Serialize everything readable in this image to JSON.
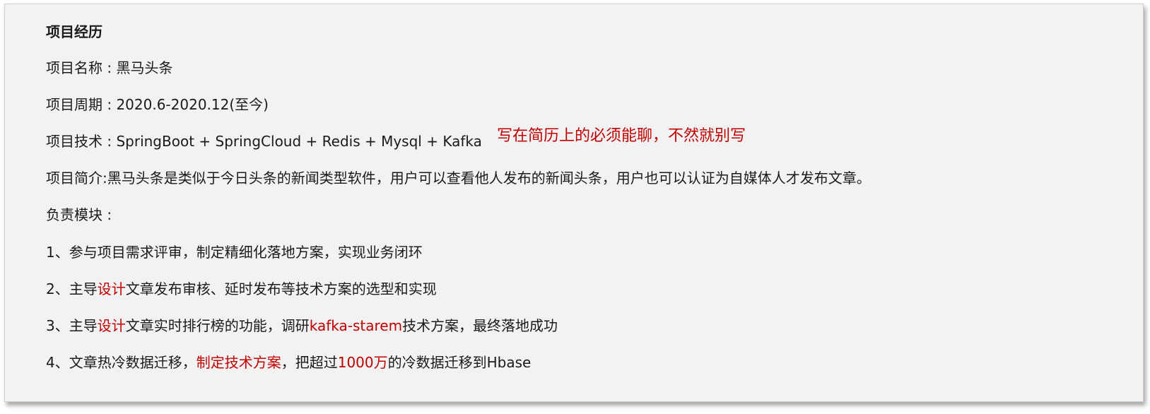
{
  "heading": "项目经历",
  "project_name": {
    "label": "项目名称 : ",
    "value": "黑马头条"
  },
  "project_period": {
    "label": "项目周期 : ",
    "value": "2020.6-2020.12(至今)"
  },
  "project_tech": {
    "label": "项目技术 : ",
    "value": "SpringBoot + SpringCloud + Redis + Mysql + Kafka"
  },
  "tech_note": "写在简历上的必须能聊，不然就别写",
  "project_intro": {
    "label": "项目简介:",
    "value": "黑马头条是类似于今日头条的新闻类型软件，用户可以查看他人发布的新闻头条，用户也可以认证为自媒体人才发布文章。"
  },
  "modules_label": "负责模块 :",
  "modules": {
    "m1": {
      "text": "1、参与项目需求评审，制定精细化落地方案，实现业务闭环"
    },
    "m2": {
      "pre": "2、主导",
      "hl": "设计",
      "post": "文章发布审核、延时发布等技术方案的选型和实现"
    },
    "m3": {
      "pre": "3、主导",
      "hl": "设计",
      "mid": "文章实时排行榜的功能，调研",
      "hl2": "kafka-starem",
      "post": "技术方案，最终落地成功"
    },
    "m4": {
      "pre": "4、文章热冷数据迁移，",
      "hl": "制定技术方案",
      "mid": "，把超过",
      "hl2": "1000万",
      "post": "的冷数据迁移到Hbase"
    }
  },
  "colors": {
    "highlight": "#c00000",
    "background": "#f2f2f2",
    "text": "#1a1a1a"
  }
}
